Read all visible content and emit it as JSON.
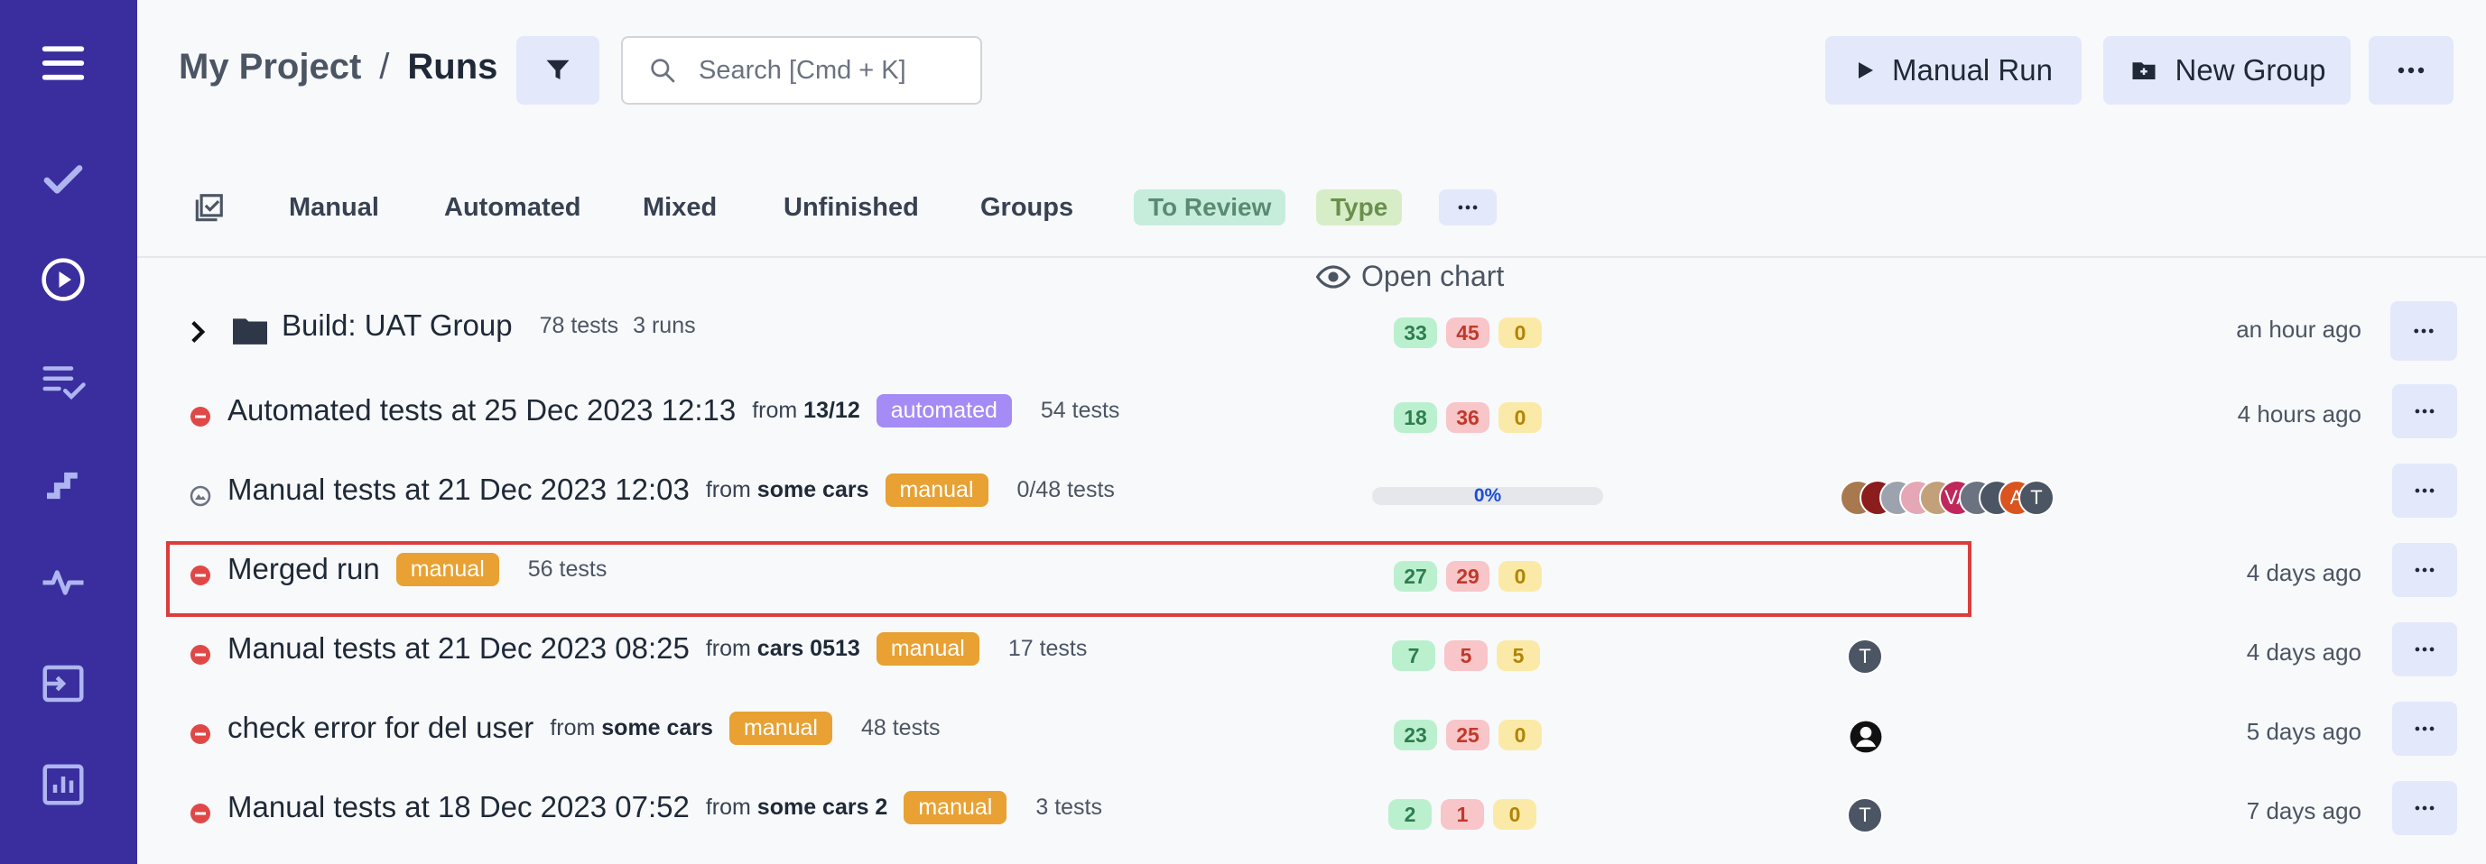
{
  "breadcrumb": {
    "project": "My Project",
    "separator": "/",
    "current": "Runs"
  },
  "search": {
    "placeholder": "Search [Cmd + K]"
  },
  "header": {
    "manual_run": "Manual Run",
    "new_group": "New Group"
  },
  "tabs": {
    "manual": "Manual",
    "automated": "Automated",
    "mixed": "Mixed",
    "unfinished": "Unfinished",
    "groups": "Groups",
    "to_review": "To Review",
    "type": "Type"
  },
  "open_chart": "Open chart",
  "rows": [
    {
      "title": "Build: UAT Group",
      "tests": "78 tests",
      "runs": "3 runs",
      "passed": "33",
      "failed": "45",
      "skipped": "0",
      "time": "an hour ago"
    },
    {
      "title": "Automated tests at 25 Dec 2023 12:13",
      "from": "from",
      "from_name": "13/12",
      "tag": "automated",
      "tests": "54 tests",
      "passed": "18",
      "failed": "36",
      "skipped": "0",
      "time": "4 hours ago"
    },
    {
      "title": "Manual tests at 21 Dec 2023 12:03",
      "from": "from",
      "from_name": "some cars",
      "tag": "manual",
      "tests": "0/48 tests",
      "progress": "0%"
    },
    {
      "title": "Merged run",
      "tag": "manual",
      "tests": "56 tests",
      "passed": "27",
      "failed": "29",
      "skipped": "0",
      "time": "4 days ago"
    },
    {
      "title": "Manual tests at 21 Dec 2023 08:25",
      "from": "from",
      "from_name": "cars 0513",
      "tag": "manual",
      "tests": "17 tests",
      "passed": "7",
      "failed": "5",
      "skipped": "5",
      "avatar": "T",
      "time": "4 days ago"
    },
    {
      "title": "check error for del user",
      "from": "from",
      "from_name": "some cars",
      "tag": "manual",
      "tests": "48 tests",
      "passed": "23",
      "failed": "25",
      "skipped": "0",
      "time": "5 days ago"
    },
    {
      "title": "Manual tests at 18 Dec 2023 07:52",
      "from": "from",
      "from_name": "some cars 2",
      "tag": "manual",
      "tests": "3 tests",
      "passed": "2",
      "failed": "1",
      "skipped": "0",
      "avatar": "T",
      "time": "7 days ago"
    }
  ],
  "assignees_row3": [
    "VA",
    "A",
    "T"
  ],
  "colors": {
    "sidebar": "#3a2e9e",
    "accent_button": "#e3e8fb",
    "manual_tag": "#e8a132",
    "automated_tag": "#a58bf5",
    "selection": "#dc3d3d"
  }
}
